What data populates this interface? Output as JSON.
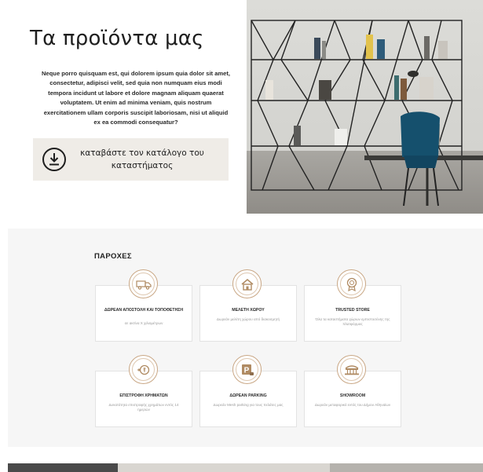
{
  "hero": {
    "title": "Τα προϊόντα μας",
    "intro": "Neque porro quisquam est, qui dolorem ipsum quia dolor sit amet, consectetur, adipisci velit, sed quia non numquam eius modi tempora incidunt ut labore et dolore magnam aliquam quaerat voluptatem. Ut enim ad minima veniam, quis nostrum exercitationem ullam corporis suscipit laboriosam, nisi ut aliquid ex ea commodi consequatur?",
    "catalog_button": "καταβάστε τον κατάλογο του καταστήματος"
  },
  "services": {
    "title": "ΠΑΡΟΧΕΣ",
    "items": [
      {
        "name": "ΔΩΡΕΑΝ ΑΠΟΣΤΟΛΗ ΚΑΙ ΤΟΠΟΘΕΤΗΣΗ",
        "desc": "σε ακτίνα Χ χιλιομέτρων",
        "icon": "delivery-truck-icon"
      },
      {
        "name": "ΜΕΛΕΤΗ ΧΩΡΟΥ",
        "desc": "Δωρεάν μελέτη χώρου από διακοσμητή",
        "icon": "house-icon"
      },
      {
        "name": "TRUSTED STORE",
        "desc": "Όλα τα καταστήματα χώρων εμπιστοσύνης της πλατφόρμας",
        "icon": "award-icon"
      },
      {
        "name": "ΕΠΙΣΤΡΟΦΗ ΧΡΗΜΑΤΩΝ",
        "desc": "Δυνατότητα επιστροφής χρημάτων εντός 14 ημερών",
        "icon": "money-return-icon"
      },
      {
        "name": "ΔΩΡΕΑΝ PARKING",
        "desc": "Δωρεάν Mesh parking για τους πελάτες μας",
        "icon": "parking-icon"
      },
      {
        "name": "SHOWROOM",
        "desc": "Δωρεάν μεταφορικό εντός του Δήμου Αθηναίων",
        "icon": "showroom-icon"
      }
    ]
  },
  "colors": {
    "accent": "#c9a785",
    "button_bg": "#efece7",
    "section_bg": "#f6f6f6"
  }
}
